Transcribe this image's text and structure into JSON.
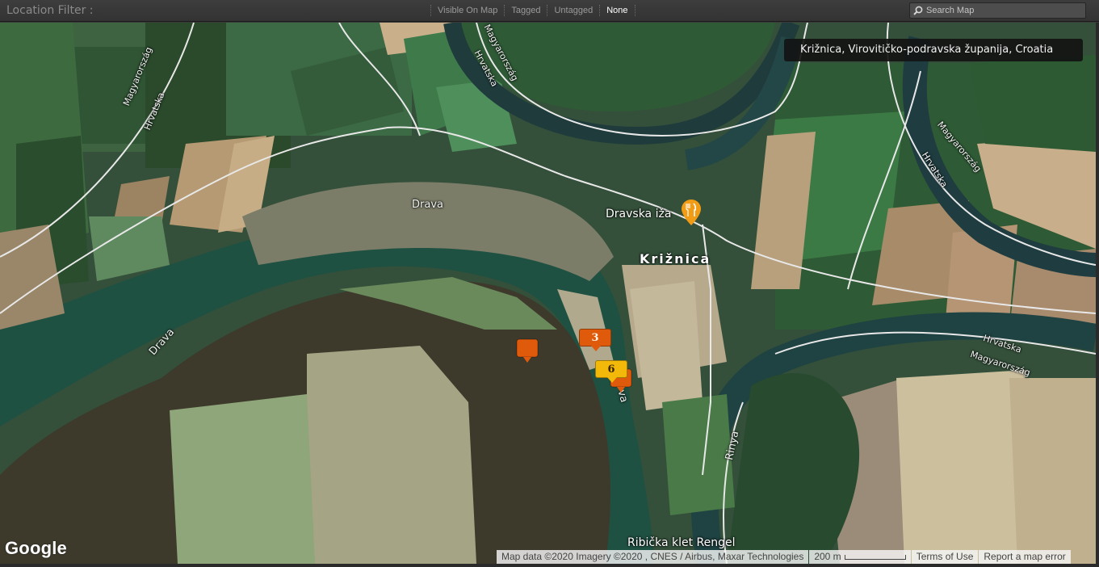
{
  "filter_bar": {
    "title": "Location Filter :",
    "options": [
      {
        "label": "Visible On Map",
        "active": false
      },
      {
        "label": "Tagged",
        "active": false
      },
      {
        "label": "Untagged",
        "active": false
      },
      {
        "label": "None",
        "active": true
      }
    ],
    "search_placeholder": "Search Map",
    "search_icon": "magnifier-icon"
  },
  "map": {
    "location_chip": "Križnica, Virovitičko-podravska županija, Croatia",
    "labels": {
      "drava_upper": "Drava",
      "drava_lower": "Drava",
      "drava_partial": "va",
      "rinya": "Rinya",
      "town": "Križnica",
      "restaurant": "Dravska iža",
      "restaurant_icon": "fork-knife-icon",
      "place_bottom": "Ribička klet Rengel",
      "road_left_1": "Magyarország",
      "road_left_2": "Hrvatska",
      "road_top_1": "Magyarország",
      "road_top_2": "Hrvatska",
      "road_right_1": "Magyarország",
      "road_right_2": "Hrvatska",
      "road_mid_1": "Hrvatska",
      "road_mid_2": "Magyarország"
    },
    "markers": [
      {
        "type": "single",
        "color": "#e05a0c"
      },
      {
        "type": "cluster",
        "count": "3",
        "color": "#e05a0c"
      },
      {
        "type": "cluster",
        "count": "6",
        "color": "#f2b90b"
      },
      {
        "type": "single",
        "color": "#e05a0c"
      }
    ],
    "google_logo": "Google",
    "attribution": {
      "data": "Map data ©2020 Imagery ©2020 , CNES / Airbus, Maxar Technologies",
      "scale": "200 m",
      "terms": "Terms of Use",
      "report": "Report a map error"
    }
  }
}
